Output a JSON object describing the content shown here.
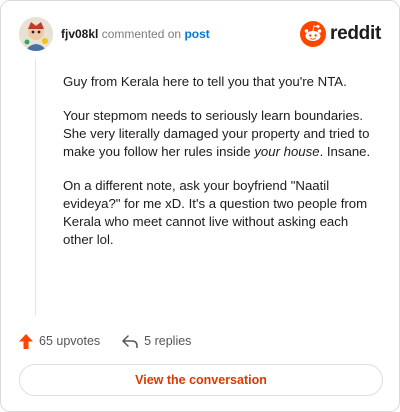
{
  "header": {
    "username": "fjv08kl",
    "commented_on": "commented on",
    "post_link": "post",
    "brand": "reddit"
  },
  "comment": {
    "paragraphs": {
      "p1": "Guy from Kerala here to tell you that you're NTA.",
      "p2_before": "Your stepmom needs to seriously learn boundaries. She very literally damaged your property and tried to make you follow her rules inside ",
      "p2_em": "your house",
      "p2_after": ". Insane.",
      "p3": "On a different note, ask your boyfriend \"Naatil evideya?\" for me xD. It's a question two people from Kerala who meet cannot live without asking each other lol."
    }
  },
  "actions": {
    "upvotes": "65 upvotes",
    "replies": "5 replies"
  },
  "footer": {
    "view_conversation": "View the conversation"
  },
  "colors": {
    "upvote": "#ff4500",
    "link": "#0079d3",
    "button_text": "#d93a00"
  }
}
